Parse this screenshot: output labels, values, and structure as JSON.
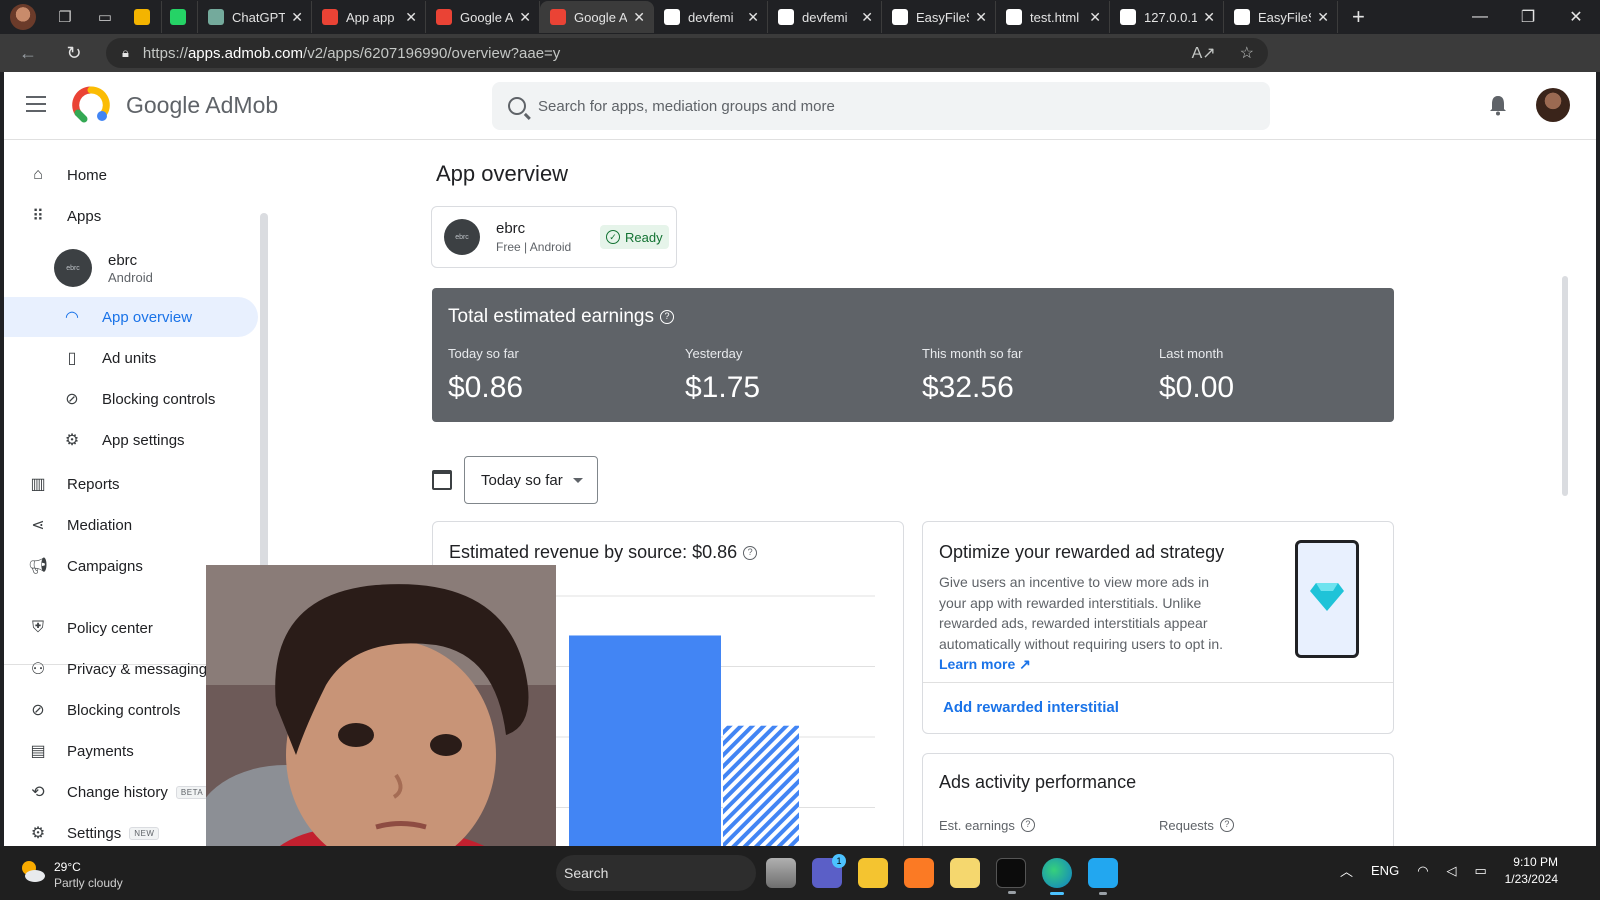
{
  "browser": {
    "tabs": [
      {
        "label": "",
        "icon": "sticker-icon",
        "color": "#f4b400",
        "small": true
      },
      {
        "label": "",
        "icon": "whatsapp-icon",
        "color": "#25d366",
        "small": true
      },
      {
        "label": "ChatGPT",
        "icon": "chatgpt-icon",
        "color": "#74aa9c"
      },
      {
        "label": "App app",
        "icon": "gmail-icon",
        "color": "#ea4335"
      },
      {
        "label": "Google A",
        "icon": "admob-icon",
        "color": "#ea4335"
      },
      {
        "label": "Google A",
        "icon": "admob-icon",
        "color": "#ea4335",
        "active": true
      },
      {
        "label": "devfemi",
        "icon": "github-icon",
        "color": "#ffffff"
      },
      {
        "label": "devfemi",
        "icon": "github-icon",
        "color": "#ffffff"
      },
      {
        "label": "EasyFileS",
        "icon": "cloud-icon",
        "color": "#ffffff"
      },
      {
        "label": "test.html",
        "icon": "file-icon",
        "color": "#ffffff"
      },
      {
        "label": "127.0.0.1",
        "icon": "file-icon",
        "color": "#ffffff"
      },
      {
        "label": "EasyFileS",
        "icon": "cloud-icon",
        "color": "#ffffff"
      }
    ],
    "url_prefix": "https://",
    "url_host": "apps.admob.com",
    "url_path": "/v2/apps/6207196990/overview?aae=y"
  },
  "appbar": {
    "brand_google": "Google",
    "brand_admob": "AdMob",
    "search_placeholder": "Search for apps, mediation groups and more"
  },
  "sidebar": {
    "items": [
      {
        "label": "Home",
        "icon": "home-icon",
        "level": 1
      },
      {
        "label": "Apps",
        "icon": "apps-grid-icon",
        "level": 1
      }
    ],
    "app": {
      "name": "ebrc",
      "platform": "Android",
      "icon_text": "ebrc"
    },
    "app_items": [
      {
        "label": "App overview",
        "icon": "gauge-icon",
        "active": true
      },
      {
        "label": "Ad units",
        "icon": "ad-unit-icon"
      },
      {
        "label": "Blocking controls",
        "icon": "block-icon"
      },
      {
        "label": "App settings",
        "icon": "settings-icon"
      }
    ],
    "more_items": [
      {
        "label": "Reports",
        "icon": "bar-chart-icon"
      },
      {
        "label": "Mediation",
        "icon": "mediation-icon"
      },
      {
        "label": "Campaigns",
        "icon": "megaphone-icon"
      }
    ],
    "bottom_items": [
      {
        "label": "Policy center",
        "icon": "shield-icon"
      },
      {
        "label": "Privacy & messaging",
        "icon": "privacy-icon"
      },
      {
        "label": "Blocking controls",
        "icon": "block-icon"
      },
      {
        "label": "Payments",
        "icon": "payments-icon"
      },
      {
        "label": "Change history",
        "icon": "history-icon",
        "badge": "BETA"
      },
      {
        "label": "Settings",
        "icon": "settings-icon",
        "badge": "NEW"
      }
    ]
  },
  "main": {
    "title": "App overview",
    "app_card": {
      "name": "ebrc",
      "subtitle": "Free | Android",
      "status": "Ready",
      "icon_text": "ebrc"
    },
    "earnings": {
      "title": "Total estimated earnings",
      "metrics": [
        {
          "label": "Today so far",
          "value": "$0.86"
        },
        {
          "label": "Yesterday",
          "value": "$1.75"
        },
        {
          "label": "This month so far",
          "value": "$32.56"
        },
        {
          "label": "Last month",
          "value": "$0.00"
        }
      ]
    },
    "date_range": "Today so far",
    "revenue_card": {
      "title": "Estimated revenue by source: $0.86"
    },
    "optimize_card": {
      "title": "Optimize your rewarded ad strategy",
      "body": "Give users an incentive to view more ads in your app with rewarded interstitials. Unlike rewarded ads, rewarded interstitials appear automatically without requiring users to opt in.",
      "link": "Learn more",
      "action": "Add rewarded interstitial"
    },
    "activity_card": {
      "title": "Ads activity performance",
      "col1": "Est. earnings",
      "col2": "Requests"
    }
  },
  "chart_data": {
    "type": "bar",
    "title": "Estimated revenue by source: $0.86",
    "series": [
      {
        "values": [
          0.86
        ],
        "pattern": "solid",
        "color": "#4285f4"
      },
      {
        "values": [
          0.54
        ],
        "pattern": "hatched",
        "color": "#4285f4"
      }
    ],
    "ylim": [
      0,
      1
    ],
    "grid": true
  },
  "taskbar": {
    "temperature": "29°C",
    "weather": "Partly cloudy",
    "search": "Search",
    "language": "ENG",
    "time": "9:10 PM",
    "date": "1/23/2024",
    "teams_badge": "1"
  }
}
